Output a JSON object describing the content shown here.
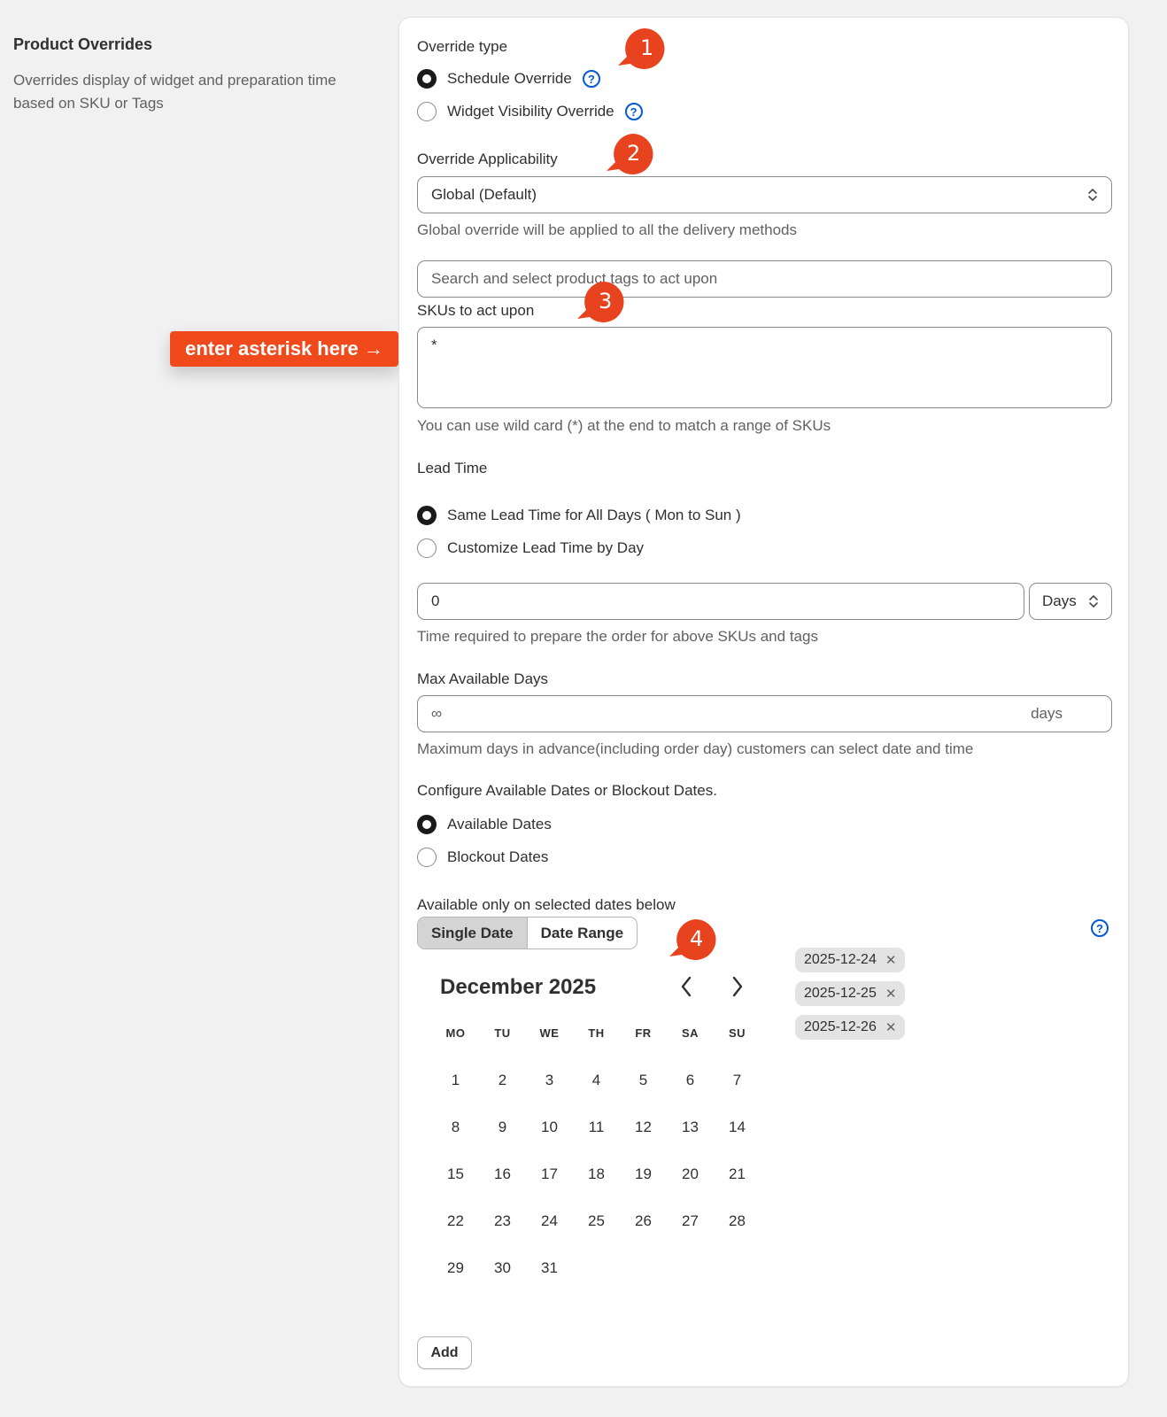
{
  "section": {
    "title": "Product Overrides",
    "description": "Overrides display of widget and preparation time based on SKU or Tags"
  },
  "override_type": {
    "label": "Override type",
    "options": [
      "Schedule Override",
      "Widget Visibility Override"
    ],
    "selected": "Schedule Override"
  },
  "applicability": {
    "label": "Override Applicability",
    "value": "Global (Default)",
    "help": "Global override will be applied to all the delivery methods"
  },
  "tags_search": {
    "placeholder": "Search and select product tags to act upon"
  },
  "skus": {
    "label": "SKUs to act upon",
    "value": "*",
    "help": "You can use wild card (*) at the end to match a range of SKUs"
  },
  "lead_time": {
    "label": "Lead Time",
    "options": [
      "Same Lead Time for All Days ( Mon to Sun )",
      "Customize Lead Time by Day"
    ],
    "selected": "Same Lead Time for All Days ( Mon to Sun )",
    "value": "0",
    "unit": "Days",
    "help": "Time required to prepare the order for above SKUs and tags"
  },
  "max_days": {
    "label": "Max Available Days",
    "value": "∞",
    "suffix": "days",
    "help": "Maximum days in advance(including order day) customers can select date and time"
  },
  "dates_config": {
    "label": "Configure Available Dates or Blockout Dates.",
    "options": [
      "Available Dates",
      "Blockout Dates"
    ],
    "selected": "Available Dates",
    "sub_label": "Available only on selected dates below"
  },
  "date_mode": {
    "tabs": [
      "Single Date",
      "Date Range"
    ],
    "active": "Single Date"
  },
  "calendar": {
    "month": "December 2025",
    "weekdays": [
      "MO",
      "TU",
      "WE",
      "TH",
      "FR",
      "SA",
      "SU"
    ],
    "days": [
      "1",
      "2",
      "3",
      "4",
      "5",
      "6",
      "7",
      "8",
      "9",
      "10",
      "11",
      "12",
      "13",
      "14",
      "15",
      "16",
      "17",
      "18",
      "19",
      "20",
      "21",
      "22",
      "23",
      "24",
      "25",
      "26",
      "27",
      "28",
      "29",
      "30",
      "31"
    ]
  },
  "selected_dates": [
    "2025-12-24",
    "2025-12-25",
    "2025-12-26"
  ],
  "add_button": "Add",
  "annotations": {
    "markers": [
      "1",
      "2",
      "3",
      "4"
    ],
    "banner": "enter asterisk here →",
    "color": "#e8431f"
  },
  "colors": {
    "background": "#f1f1f1",
    "card": "#ffffff",
    "accent_blue": "#005bd3",
    "annotation_red": "#f04a1c"
  }
}
